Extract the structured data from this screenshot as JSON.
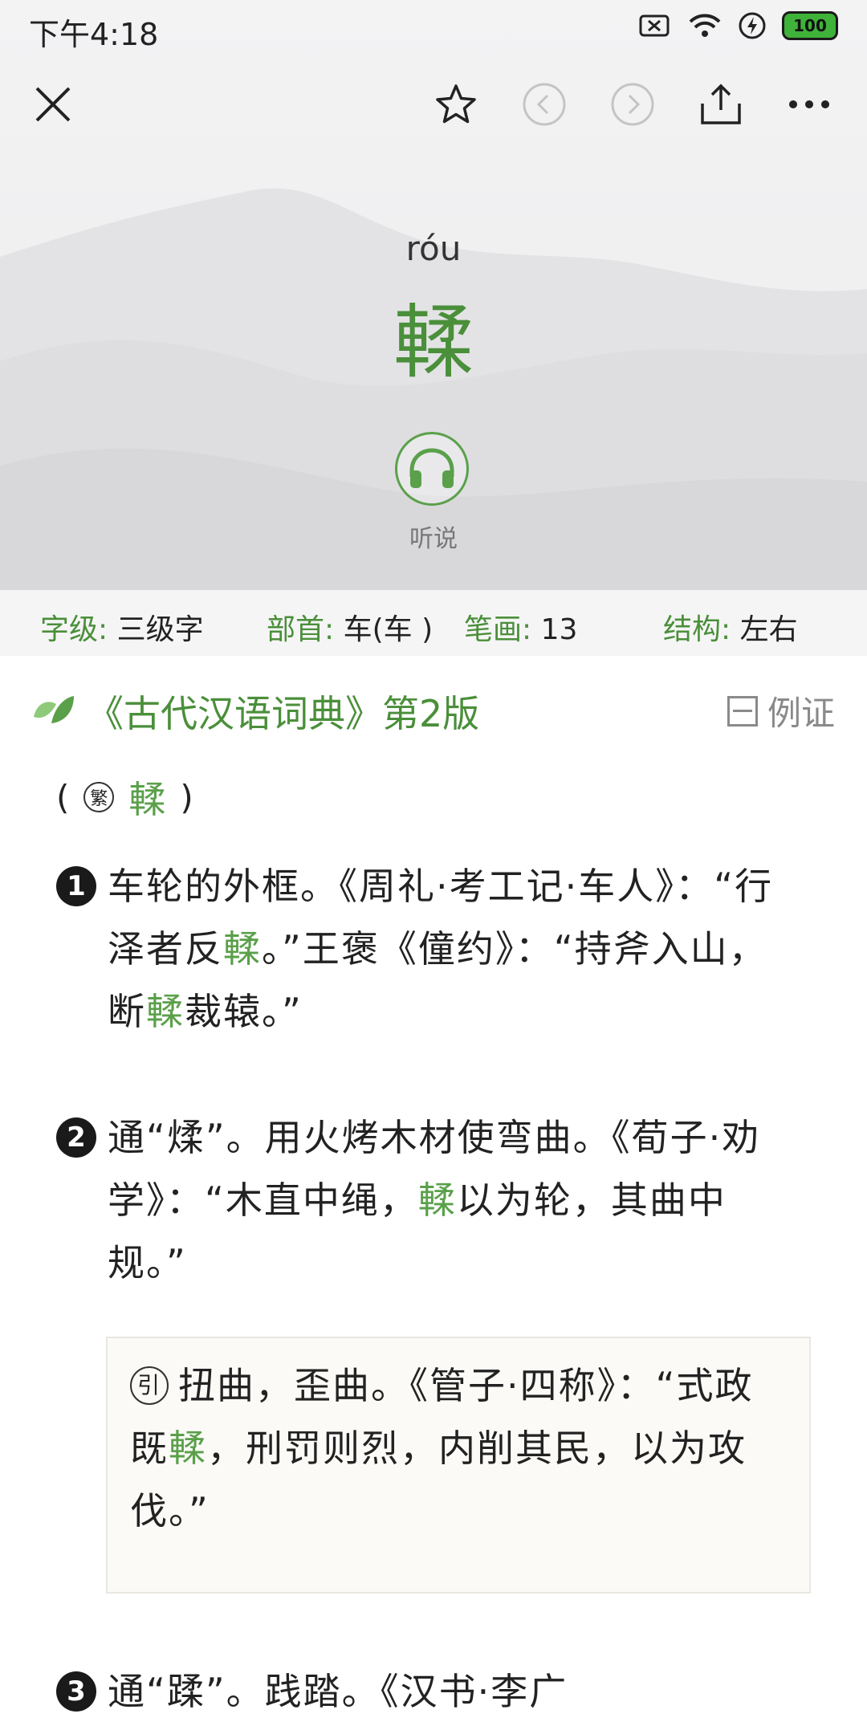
{
  "status": {
    "time": "下午4:18",
    "battery": "100"
  },
  "toolbar": {
    "close_icon": "close-icon",
    "favorite_icon": "star-icon",
    "prev_icon": "chevron-left-icon",
    "next_icon": "chevron-right-icon",
    "share_icon": "share-icon",
    "more_icon": "more-icon"
  },
  "entry": {
    "pinyin": "róu",
    "character": "輮",
    "listen_label": "听说"
  },
  "info": {
    "level_key": "字级:",
    "level_val": "三级字",
    "radical_key": "部首:",
    "radical_val": "车(车 )",
    "strokes_key": "笔画:",
    "strokes_val": "13",
    "structure_key": "结构:",
    "structure_val": "左右"
  },
  "dictionary": {
    "title": "《古代汉语词典》第2版",
    "example_label": "例证",
    "traditional_open": "(",
    "traditional_badge": "繁",
    "traditional_char": "輮",
    "traditional_close": ")"
  },
  "definitions": [
    {
      "num": "1",
      "parts": [
        "车轮的外框。《周礼·考工记·车人》：“行泽者反",
        "輮",
        "。”王褒《僮约》：“持斧入山，断",
        "輮",
        "裁辕。”"
      ]
    },
    {
      "num": "2",
      "parts": [
        "通“煣”。用火烤木材使弯曲。《荀子·劝学》：“木直中绳，",
        "輮",
        "以为轮，其曲中规。”"
      ]
    },
    {
      "num": "3",
      "parts": [
        "通“蹂”。践踏。《汉书·李广"
      ]
    }
  ],
  "extended": {
    "badge": "引",
    "parts": [
      "扭曲，歪曲。《管子·四称》：“式政既",
      "輮",
      "，刑罚则烈，内削其民，以为攻伐。”"
    ]
  },
  "colors": {
    "accent": "#4a8f3a",
    "highlight": "#5aa04a"
  }
}
